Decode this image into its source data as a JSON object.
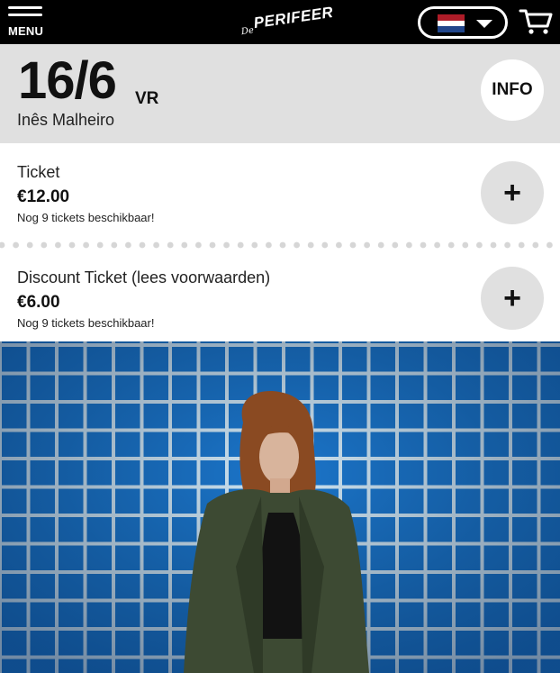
{
  "nav": {
    "menu_label": "MENU",
    "logo_prefix": "De",
    "logo_name": "PERIFEER",
    "language_flag": "nl-flag",
    "flag_colors": [
      "#ae1c28",
      "#ffffff",
      "#21468b"
    ],
    "cart_icon": "cart-icon"
  },
  "event": {
    "date": "16/6",
    "weekday": "VR",
    "artist": "Inês Malheiro",
    "info_label": "INFO"
  },
  "tickets": [
    {
      "name": "Ticket",
      "price": "€12.00",
      "availability": "Nog 9 tickets beschikbaar!",
      "add_label": "+"
    },
    {
      "name": "Discount Ticket (lees voorwaarden)",
      "price": "€6.00",
      "availability": "Nog 9 tickets beschikbaar!",
      "add_label": "+"
    }
  ],
  "colors": {
    "topbar": "#000000",
    "header_bg": "#e0e0e0",
    "tile_blue": "#1a73c9"
  }
}
